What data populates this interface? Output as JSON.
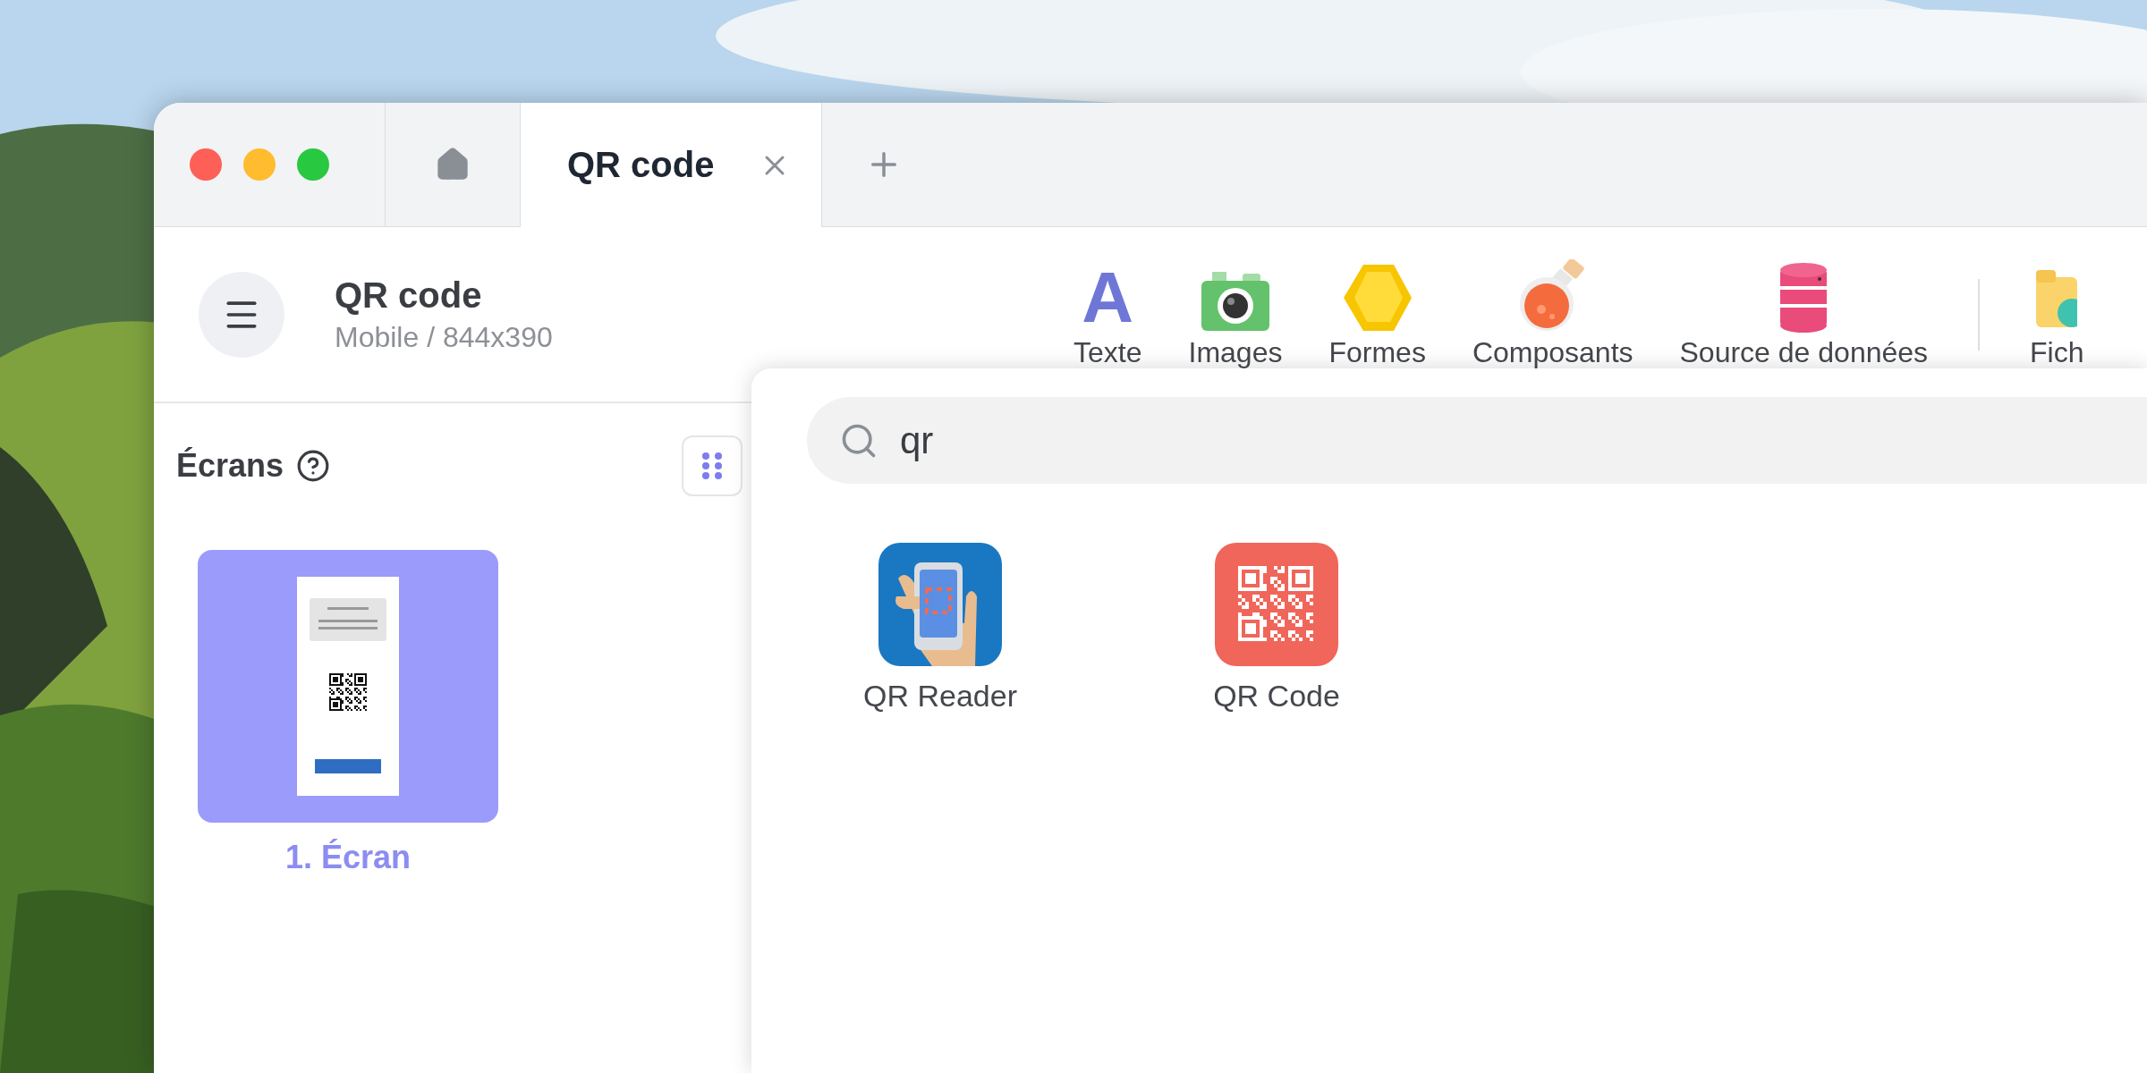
{
  "tabs": [
    {
      "kind": "home",
      "selected": false
    },
    {
      "kind": "document",
      "label": "QR code",
      "selected": true
    }
  ],
  "project": {
    "title": "QR code",
    "subtitle": "Mobile / 844x390"
  },
  "toolbar": [
    {
      "kind": "text",
      "glyph": "A",
      "label": "Texte"
    },
    {
      "kind": "images",
      "label": "Images"
    },
    {
      "kind": "shapes",
      "label": "Formes"
    },
    {
      "kind": "components",
      "label": "Composants"
    },
    {
      "kind": "data",
      "label": "Source de données"
    },
    {
      "kind": "files",
      "label": "Fich"
    }
  ],
  "screens": {
    "title": "Écrans",
    "items": [
      {
        "label": "1. Écran",
        "selected": true
      }
    ]
  },
  "search": {
    "value": "qr",
    "results": [
      {
        "kind": "reader",
        "label": "QR Reader"
      },
      {
        "kind": "qrcode",
        "label": "QR Code"
      }
    ]
  }
}
